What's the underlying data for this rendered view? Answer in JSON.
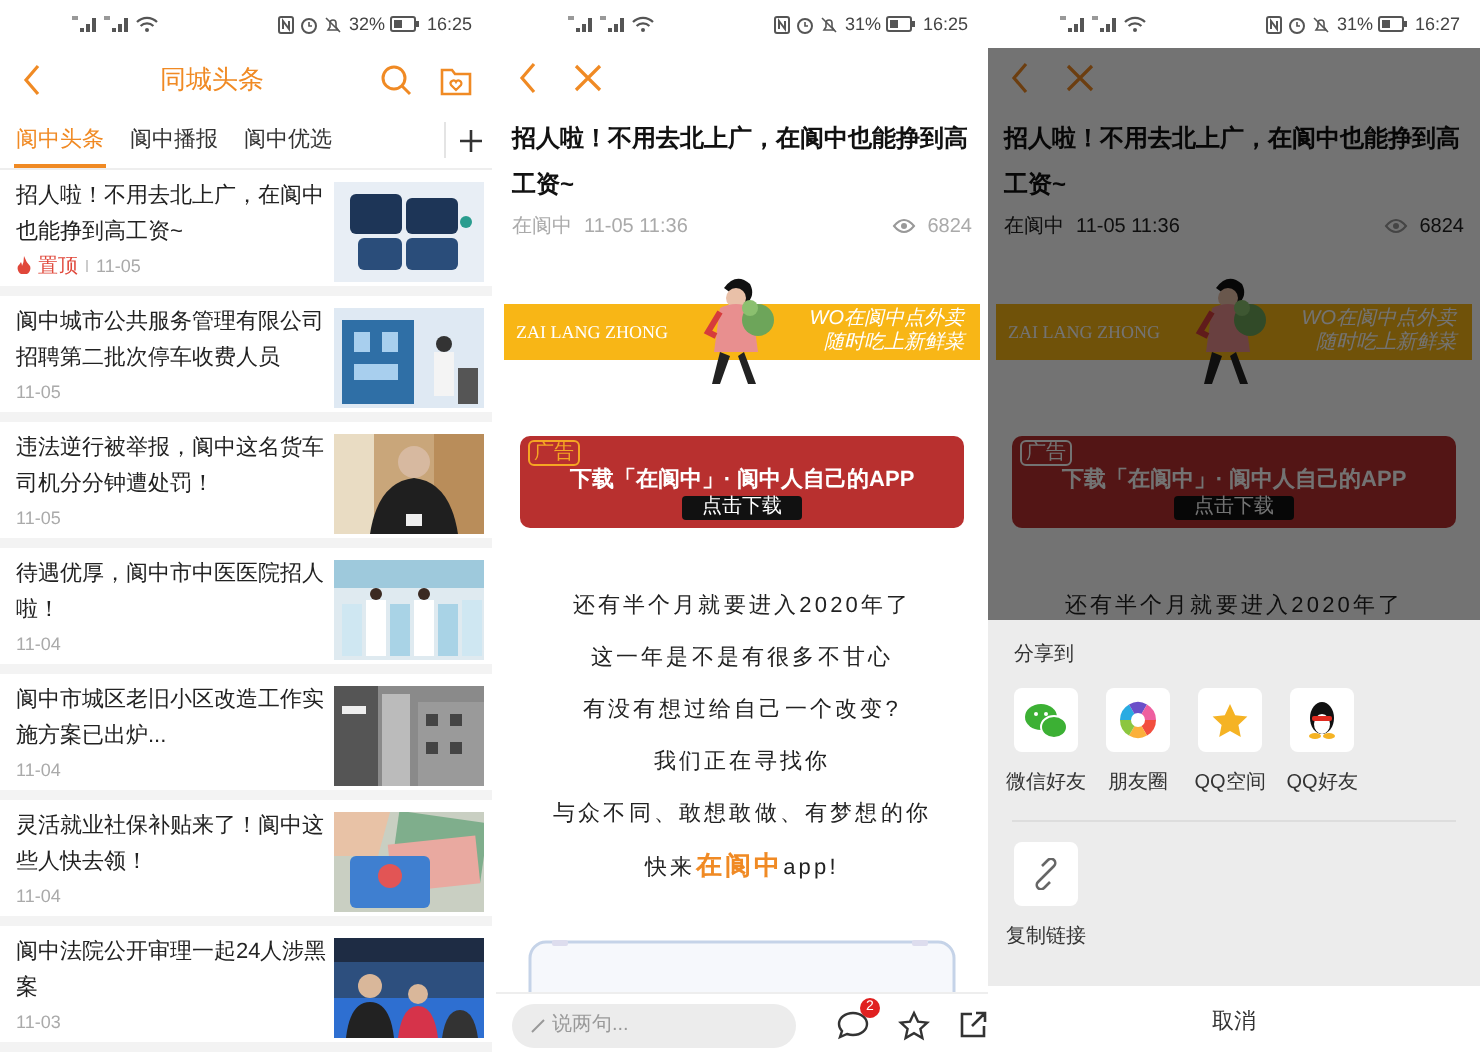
{
  "screens": [
    {
      "kind": "news_list",
      "status_bar": {
        "battery": "32%",
        "time": "16:25"
      },
      "title": "同城头条",
      "tabs": [
        {
          "label": "阆中头条",
          "selected": true
        },
        {
          "label": "阆中播报",
          "selected": false
        },
        {
          "label": "阆中优选",
          "selected": false
        }
      ],
      "articles": [
        {
          "title": "招人啦！不用去北上广，在阆中也能挣到高工资~",
          "tag": "置顶",
          "date": "11-05"
        },
        {
          "title": "阆中城市公共服务管理有限公司招聘第二批次停车收费人员",
          "date": "11-05"
        },
        {
          "title": "违法逆行被举报，阆中这名货车司机分分钟遭处罚！",
          "date": "11-05"
        },
        {
          "title": "待遇优厚，阆中市中医医院招人啦！",
          "date": "11-04"
        },
        {
          "title": "阆中市城区老旧小区改造工作实施方案已出炉...",
          "date": "11-04"
        },
        {
          "title": "灵活就业社保补贴来了！阆中这些人快去领！",
          "date": "11-04"
        },
        {
          "title": "阆中法院公开审理一起24人涉黑案",
          "date": "11-03"
        }
      ]
    },
    {
      "kind": "article",
      "status_bar": {
        "battery": "31%",
        "time": "16:25"
      },
      "title": "招人啦！不用去北上广，在阆中也能挣到高工资~",
      "source": "在阆中",
      "time": "11-05 11:36",
      "views": "6824",
      "banner": {
        "brand": "ZAI LANG ZHONG",
        "slogans": [
          "WO在阆中点外卖",
          "随时吃上新鲜菜"
        ]
      },
      "ad": {
        "badge": "广告",
        "headline": "下载「在阆中」· 阆中人自己的APP",
        "button": "点击下载"
      },
      "lines": [
        {
          "parts": [
            {
              "text": "还有半个月就要进入2020年了",
              "highlight": false
            }
          ]
        },
        {
          "parts": [
            {
              "text": "这一年是不是有很多不甘心",
              "highlight": false
            }
          ]
        },
        {
          "parts": [
            {
              "text": "有没有想过给自己一个改变?",
              "highlight": false
            }
          ]
        },
        {
          "parts": [
            {
              "text": "我们正在寻找你",
              "highlight": false
            }
          ]
        },
        {
          "parts": [
            {
              "text": "与众不同、敢想敢做、有梦想的你",
              "highlight": false
            }
          ]
        },
        {
          "parts": [
            {
              "text": "快来",
              "highlight": false
            },
            {
              "text": "在阆中",
              "highlight": true
            },
            {
              "text": "app!",
              "highlight": false
            }
          ]
        }
      ],
      "comment": {
        "placeholder": "说两句...",
        "count": "2"
      }
    },
    {
      "kind": "article_share",
      "status_bar": {
        "battery": "31%",
        "time": "16:27"
      },
      "title": "招人啦！不用去北上广，在阆中也能挣到高工资~",
      "source": "在阆中",
      "time": "11-05 11:36",
      "views": "6824",
      "banner": {
        "brand": "ZAI LANG ZHONG",
        "slogans": [
          "WO在阆中点外卖",
          "随时吃上新鲜菜"
        ]
      },
      "ad": {
        "badge": "广告",
        "headline": "下载「在阆中」· 阆中人自己的APP",
        "button": "点击下载"
      },
      "lines": [
        {
          "parts": [
            {
              "text": "还有半个月就要进入2020年了",
              "highlight": false
            }
          ]
        }
      ],
      "share": {
        "title": "分享到",
        "targets": [
          {
            "label": "微信好友",
            "kind": "wechat"
          },
          {
            "label": "朋友圈",
            "kind": "moments"
          },
          {
            "label": "QQ空间",
            "kind": "qzone"
          },
          {
            "label": "QQ好友",
            "kind": "qq"
          }
        ],
        "extra": [
          {
            "label": "复制链接",
            "kind": "link"
          }
        ],
        "cancel": "取消"
      }
    }
  ]
}
